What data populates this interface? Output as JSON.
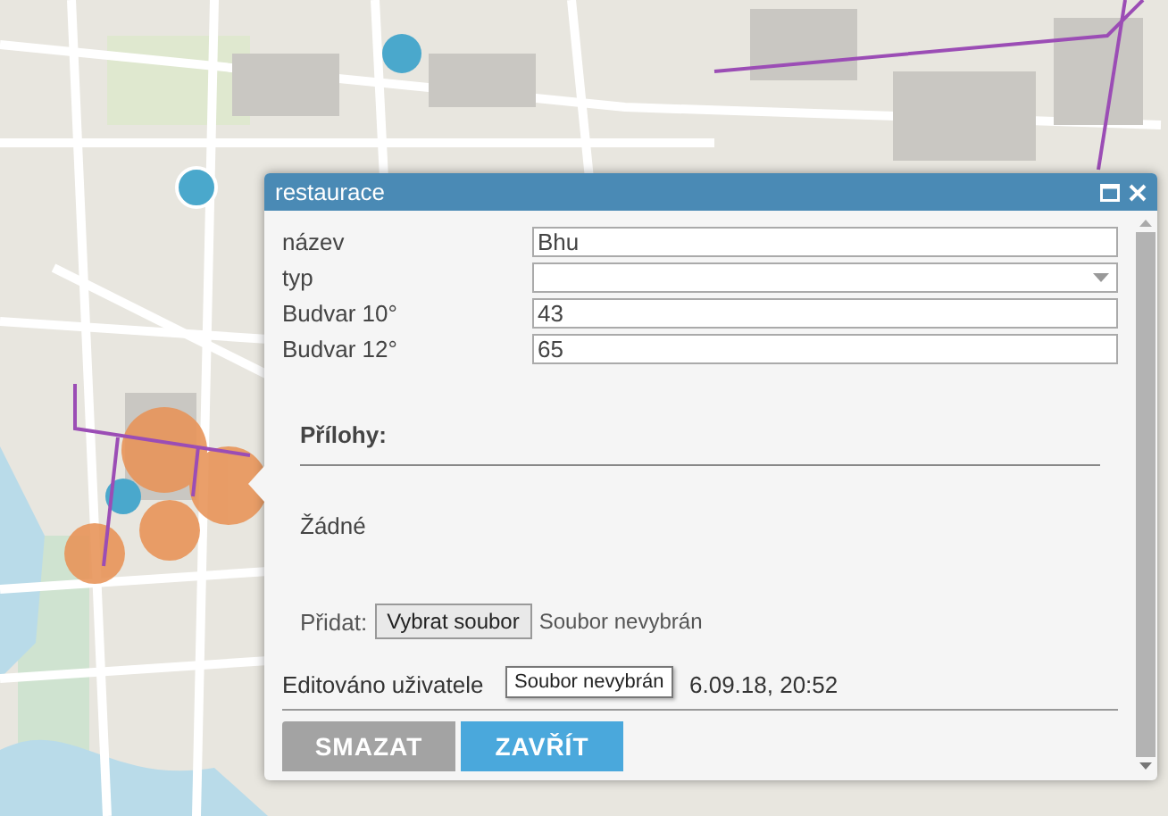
{
  "popup": {
    "title": "restaurace",
    "fields": [
      {
        "label": "název",
        "kind": "text",
        "value": "Bhu"
      },
      {
        "label": "typ",
        "kind": "select"
      },
      {
        "label": "Budvar 10°",
        "kind": "text",
        "value": "43"
      },
      {
        "label": "Budvar 12°",
        "kind": "text",
        "value": "65"
      }
    ],
    "attachments": {
      "heading": "Přílohy:",
      "empty_text": "Žádné",
      "add_label": "Přidat:",
      "file_button": "Vybrat soubor",
      "file_status": "Soubor nevybrán"
    },
    "edit_info": {
      "visible_start": "Editováno uživatele",
      "visible_end": "6.09.18, 20:52"
    },
    "tooltip": "Soubor nevybrán",
    "buttons": [
      {
        "label": "SMAZAT",
        "kind": "secondary"
      },
      {
        "label": "ZAVŘÍT",
        "kind": "primary"
      }
    ]
  }
}
